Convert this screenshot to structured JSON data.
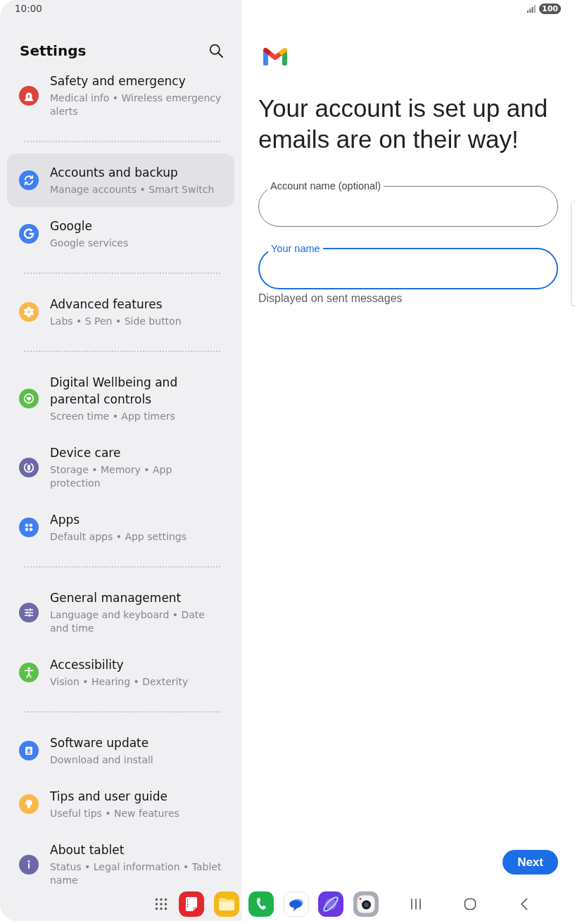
{
  "status_bar": {
    "time": "10:00",
    "battery": "100"
  },
  "settings": {
    "title": "Settings",
    "groups": [
      {
        "items": [
          {
            "title": "Safety and emergency",
            "subtitle": "Medical info • Wireless emergency alerts",
            "color": "#dc433c",
            "selected": false
          }
        ]
      },
      {
        "items": [
          {
            "title": "Accounts and backup",
            "subtitle": "Manage accounts • Smart Switch",
            "color": "#3f7ff3",
            "selected": true
          },
          {
            "title": "Google",
            "subtitle": "Google services",
            "color": "#3f7ff3",
            "selected": false
          }
        ]
      },
      {
        "items": [
          {
            "title": "Advanced features",
            "subtitle": "Labs • S Pen • Side button",
            "color": "#f9b84a",
            "selected": false
          }
        ]
      },
      {
        "items": [
          {
            "title": "Digital Wellbeing and parental controls",
            "subtitle": "Screen time • App timers",
            "color": "#5cbf47",
            "selected": false
          },
          {
            "title": "Device care",
            "subtitle": "Storage • Memory • App protection",
            "color": "#6d69a8",
            "selected": false
          },
          {
            "title": "Apps",
            "subtitle": "Default apps • App settings",
            "color": "#3f7ff3",
            "selected": false
          }
        ]
      },
      {
        "items": [
          {
            "title": "General management",
            "subtitle": "Language and keyboard • Date and time",
            "color": "#6d69a8",
            "selected": false
          },
          {
            "title": "Accessibility",
            "subtitle": "Vision • Hearing • Dexterity",
            "color": "#5cbf47",
            "selected": false
          }
        ]
      },
      {
        "items": [
          {
            "title": "Software update",
            "subtitle": "Download and install",
            "color": "#3f7ff3",
            "selected": false
          },
          {
            "title": "Tips and user guide",
            "subtitle": "Useful tips • New features",
            "color": "#f9b84a",
            "selected": false
          },
          {
            "title": "About tablet",
            "subtitle": "Status • Legal information • Tablet name",
            "color": "#6d69a8",
            "selected": false
          }
        ]
      }
    ]
  },
  "setup": {
    "heading": "Your account is set up and emails are on their way!",
    "fields": [
      {
        "label": "Account name (optional)",
        "focused": false
      },
      {
        "label": "Your name",
        "focused": true,
        "helper": "Displayed on sent messages"
      }
    ],
    "next_button": "Next"
  }
}
